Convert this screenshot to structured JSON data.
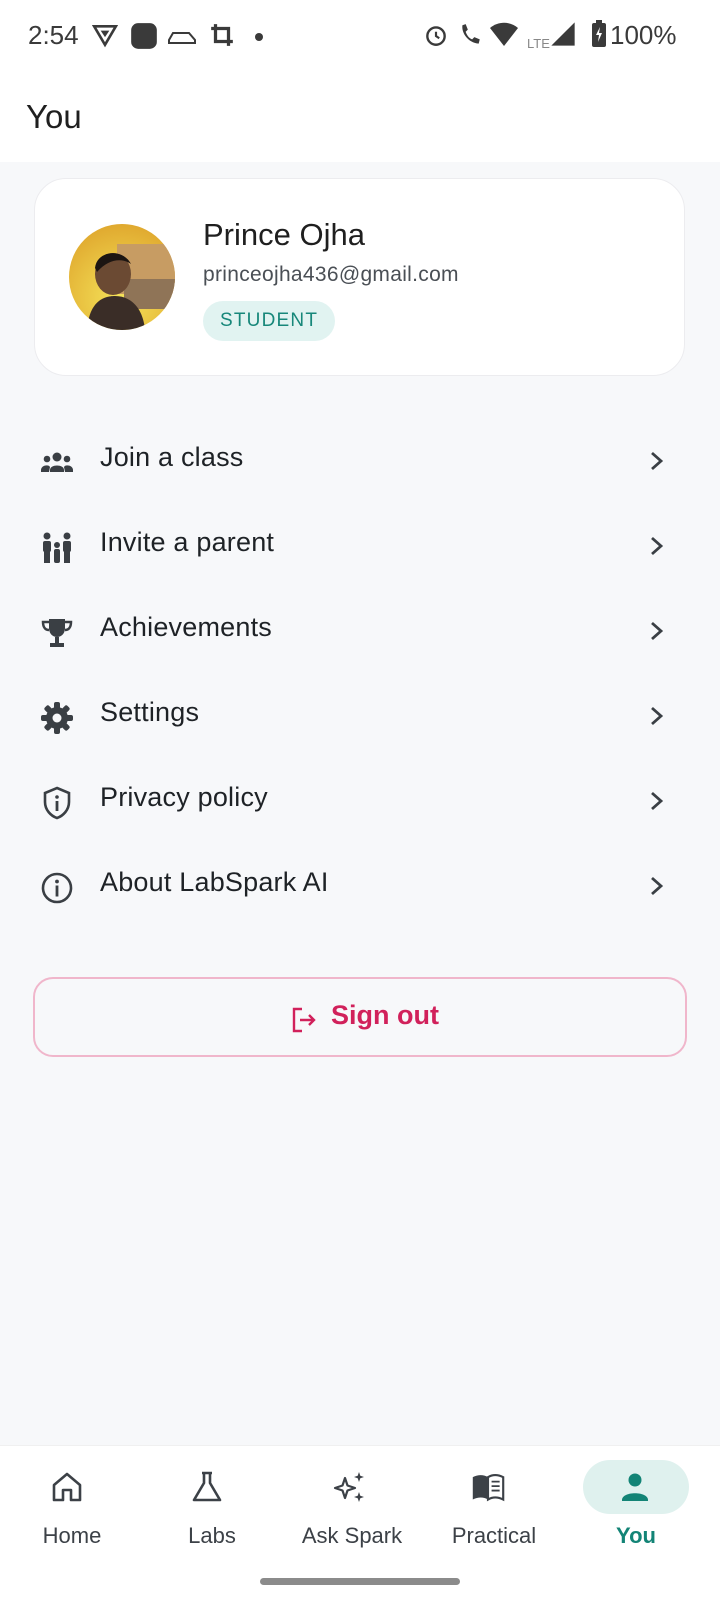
{
  "status_bar": {
    "time": "2:54",
    "battery": "100%",
    "network": "LTE",
    "icons": [
      "vpn-shield-icon",
      "app-notification-icon",
      "car-icon",
      "crop-icon",
      "dot-icon",
      "alarm-icon",
      "wifi-call-icon",
      "wifi-icon",
      "signal-icon",
      "battery-icon"
    ]
  },
  "appbar": {
    "title": "You"
  },
  "profile": {
    "name": "Prince Ojha",
    "email": "princeojha436@gmail.com",
    "role": "STUDENT"
  },
  "menu": {
    "items": [
      {
        "label": "Join a class",
        "icon": "group-icon"
      },
      {
        "label": "Invite a parent",
        "icon": "family-icon"
      },
      {
        "label": "Achievements",
        "icon": "trophy-icon"
      },
      {
        "label": "Settings",
        "icon": "gear-icon"
      },
      {
        "label": "Privacy policy",
        "icon": "shield-icon"
      },
      {
        "label": "About LabSpark AI",
        "icon": "info-icon"
      }
    ]
  },
  "signout": {
    "label": "Sign out"
  },
  "bottom_nav": {
    "items": [
      {
        "label": "Home",
        "icon": "home-icon"
      },
      {
        "label": "Labs",
        "icon": "flask-icon"
      },
      {
        "label": "Ask Spark",
        "icon": "sparkle-icon"
      },
      {
        "label": "Practical",
        "icon": "book-icon"
      },
      {
        "label": "You",
        "icon": "person-icon",
        "active": true
      }
    ]
  },
  "colors": {
    "accent": "#138476",
    "danger": "#d1215b",
    "badge_bg": "#e1f3f1"
  }
}
